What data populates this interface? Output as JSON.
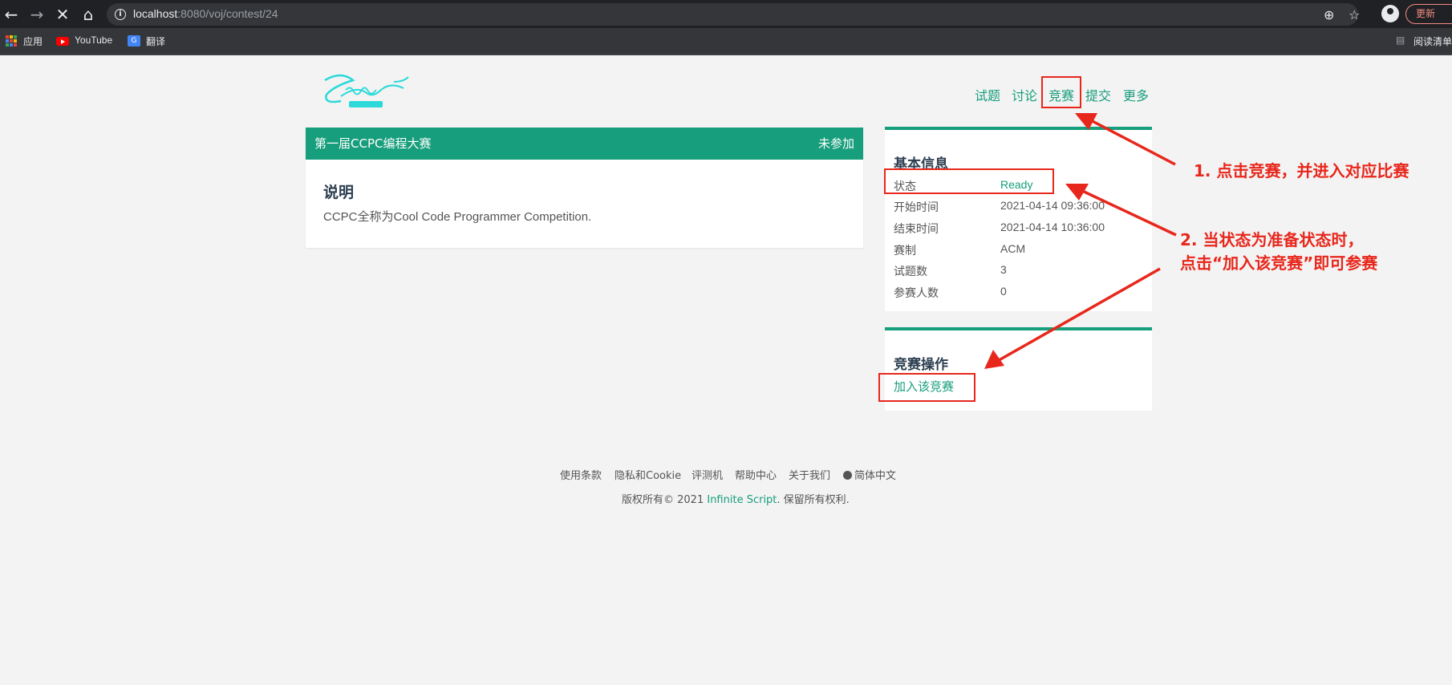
{
  "browser": {
    "url_host": "localhost",
    "url_rest": ":8080/voj/contest/24",
    "update_label": "更新",
    "bookmarks": [
      "应用",
      "YouTube",
      "翻译"
    ],
    "reading_list": "阅读清单",
    "translate_glyph": "G"
  },
  "nav": {
    "items": [
      "试题",
      "讨论",
      "竞赛",
      "提交",
      "更多"
    ]
  },
  "contest": {
    "title": "第一届CCPC编程大赛",
    "join_status": "未参加",
    "desc_title": "说明",
    "desc_text": "CCPC全称为Cool Code Programmer Competition."
  },
  "basic_info": {
    "title": "基本信息",
    "rows": [
      {
        "label": "状态",
        "value": "Ready"
      },
      {
        "label": "开始时间",
        "value": "2021-04-14 09:36:00"
      },
      {
        "label": "结束时间",
        "value": "2021-04-14 10:36:00"
      },
      {
        "label": "赛制",
        "value": "ACM"
      },
      {
        "label": "试题数",
        "value": "3"
      },
      {
        "label": "参赛人数",
        "value": "0"
      }
    ]
  },
  "contest_ops": {
    "title": "竞赛操作",
    "join_label": "加入该竞赛"
  },
  "footer": {
    "links": [
      "使用条款",
      "隐私和Cookie",
      "评测机",
      "帮助中心",
      "关于我们",
      "简体中文"
    ],
    "copyright_prefix": "版权所有© 2021 ",
    "brand": "Infinite Script",
    "copyright_suffix": ". 保留所有权利."
  },
  "annotations": {
    "step1": "1. 点击竞赛，并进入对应比赛",
    "step2_line1": "2. 当状态为准备状态时，",
    "step2_line2": "点击“加入该竞赛”即可参赛"
  },
  "colors": {
    "accent": "#179e7c",
    "annotation": "#e8271c"
  }
}
